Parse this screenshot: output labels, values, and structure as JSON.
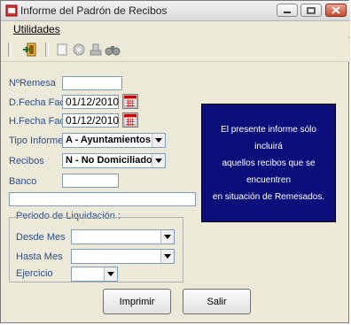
{
  "window": {
    "title": "Informe del Padrón de Recibos"
  },
  "menu": {
    "utilidades": "Utilidades"
  },
  "toolbar": {
    "icons": [
      "exit-door-icon",
      "document-icon",
      "refresh-icon",
      "stamp-icon",
      "binoculars-icon"
    ]
  },
  "form": {
    "remesa": {
      "label": "NºRemesa",
      "value": ""
    },
    "d_fecha": {
      "label": "D.Fecha Fact.",
      "value": "01/12/2010"
    },
    "h_fecha": {
      "label": "H.Fecha Fact.",
      "value": "01/12/2010"
    },
    "tipo_informe": {
      "label": "Tipo Informe",
      "value": "A - Ayuntamientos"
    },
    "recibos": {
      "label": "Recibos",
      "value": "N - No Domiciliados"
    },
    "banco": {
      "label": "Banco",
      "value": "",
      "desc": ""
    }
  },
  "info": {
    "line1": "El presente informe sólo incluirá",
    "line2": "aquellos recibos que se encuentren",
    "line3": "en situación de Remesados."
  },
  "periodo": {
    "title": "Periodo de Liquidación :",
    "desde_label": "Desde Mes",
    "desde_value": "",
    "hasta_label": "Hasta Mes",
    "hasta_value": "",
    "ejercicio_label": "Ejercicio",
    "ejercicio_value": ""
  },
  "buttons": {
    "imprimir": "Imprimir",
    "salir": "Salir"
  },
  "colors": {
    "info_bg": "#0a0f7a",
    "label": "#2d4f8a"
  }
}
